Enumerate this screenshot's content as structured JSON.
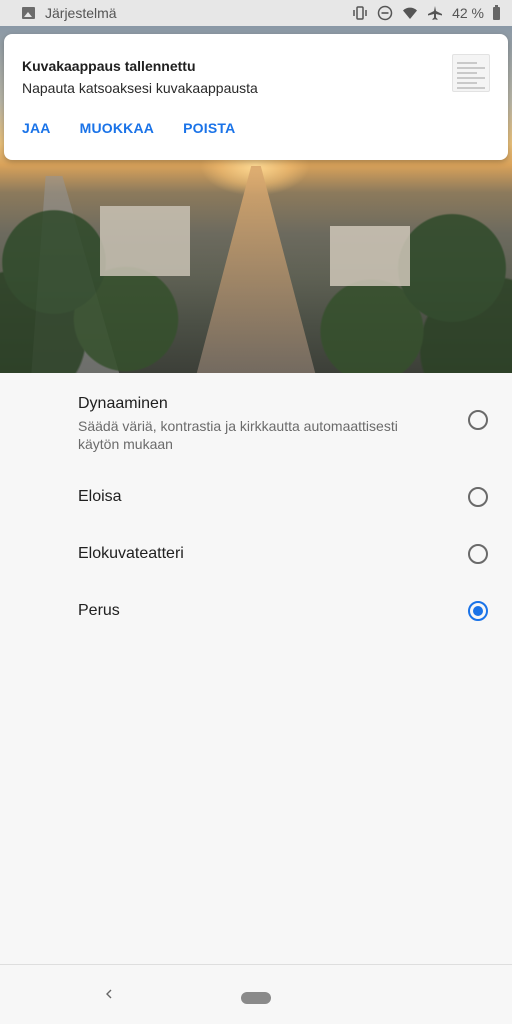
{
  "status_bar": {
    "app_label": "Järjestelmä",
    "battery": "42 %",
    "icons": [
      "image-icon",
      "vibrate-icon",
      "do-not-disturb-icon",
      "wifi-icon",
      "airplane-icon",
      "battery-icon"
    ]
  },
  "notification": {
    "title": "Kuvakaappaus tallennettu",
    "text": "Napauta katsoaksesi kuvakaappausta",
    "actions": {
      "share": "JAA",
      "edit": "MUOKKAA",
      "delete": "POISTA"
    },
    "accent": "#1a73e8"
  },
  "options": [
    {
      "label": "Dynaaminen",
      "description": "Säädä väriä, kontrastia ja kirkkautta automaattisesti käytön mukaan",
      "selected": false
    },
    {
      "label": "Eloisa",
      "selected": false
    },
    {
      "label": "Elokuvateatteri",
      "selected": false
    },
    {
      "label": "Perus",
      "selected": true
    }
  ],
  "nav": {
    "back_icon": "chevron-left-icon",
    "home_icon": "home-pill-icon"
  }
}
